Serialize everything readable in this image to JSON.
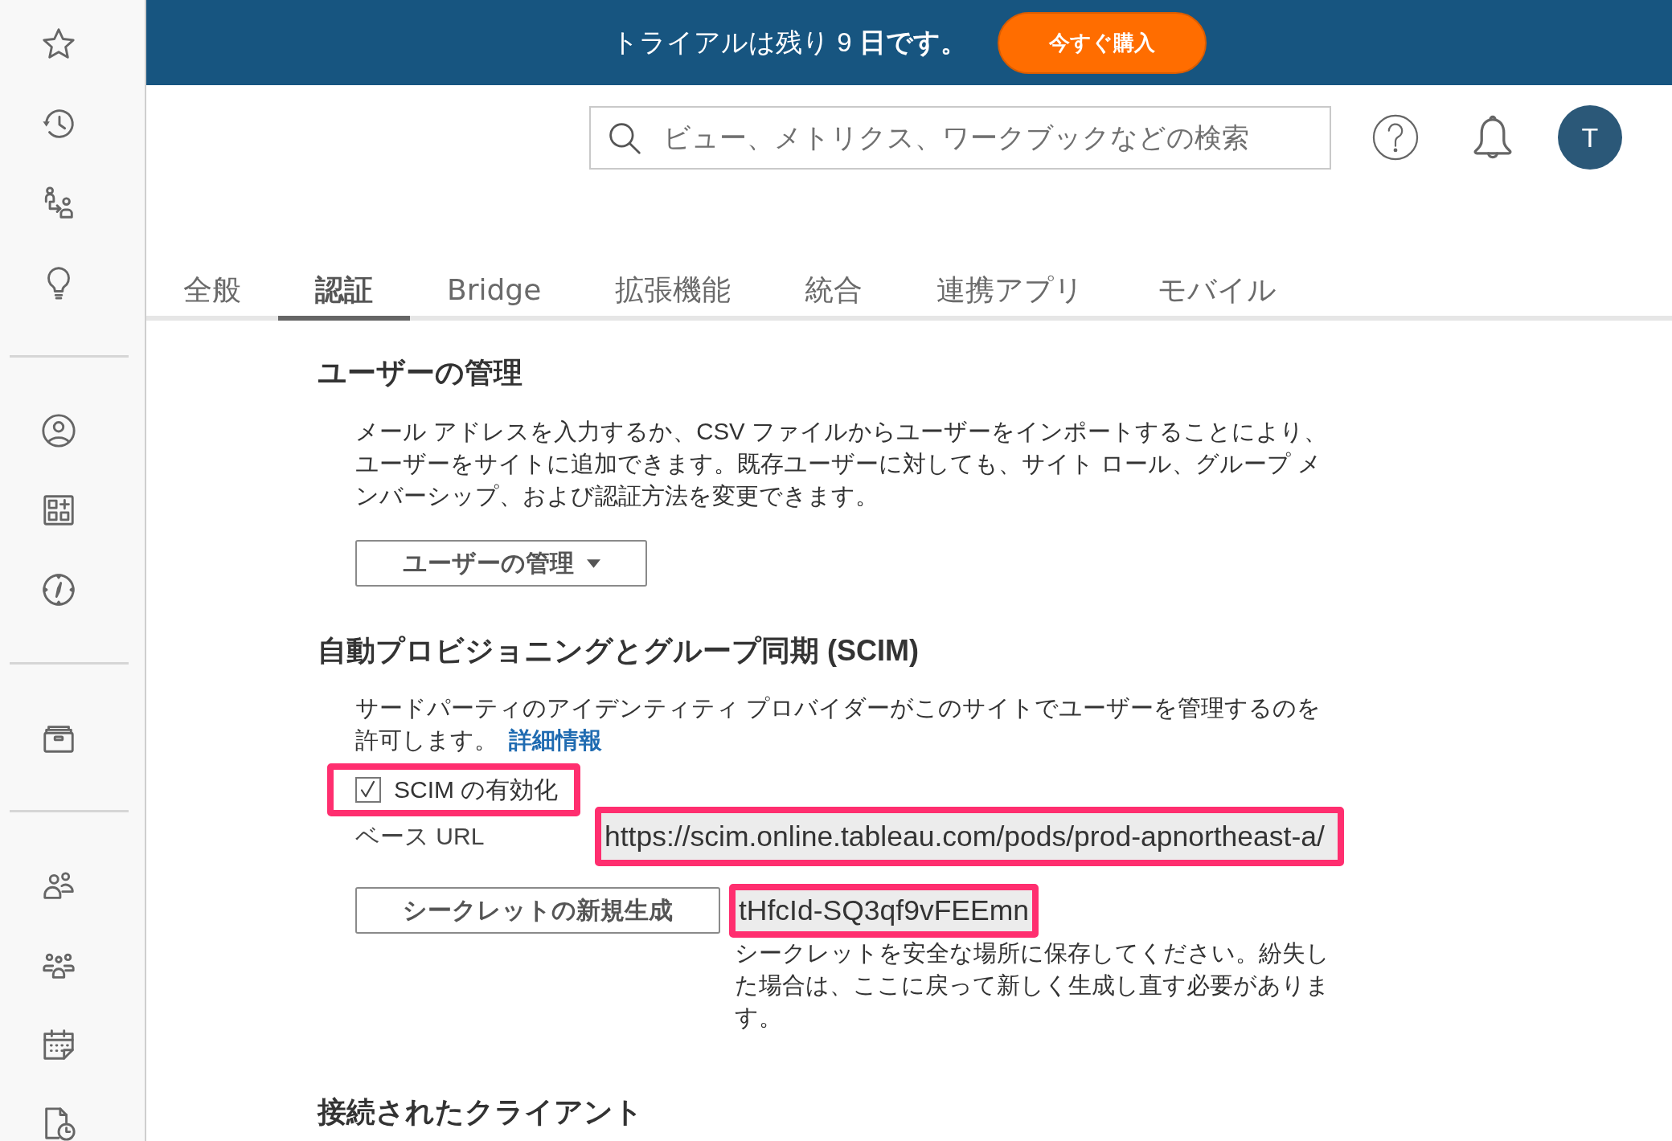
{
  "trial_banner": {
    "message": "トライアルは残り 9 **日です。**",
    "button": "今すぐ購入"
  },
  "header": {
    "search": {
      "placeholder": "ビュー、メトリクス、ワークブックなどの検索"
    },
    "avatar": "T"
  },
  "tabs": [
    {
      "label": "全般",
      "selected": false
    },
    {
      "label": "認証",
      "selected": true
    },
    {
      "label": "Bridge",
      "selected": false
    },
    {
      "label": "拡張機能",
      "selected": false
    },
    {
      "label": "統合",
      "selected": false
    },
    {
      "label": "連携アプリ",
      "selected": false
    },
    {
      "label": "モバイル",
      "selected": false
    }
  ],
  "sections": [
    {
      "kind": "user_management",
      "title": "ユーザーの管理",
      "description": "メール アドレスを入力するか、CSV ファイルからユーザーをインポートすることにより、ユーザーをサイトに追加できます。既存ユーザーに対しても、サイト ロール、グループ メンバーシップ、および認証方法を変更できます。",
      "menu_button": "ユーザーの管理"
    },
    {
      "kind": "scim",
      "title": "自動プロビジョニングとグループ同期 (SCIM)",
      "description": "サードパーティのアイデンティティ プロバイダーがこのサイトでユーザーを管理するのを許可します。",
      "link": "詳細情報",
      "enable_checkbox": {
        "label": "SCIM の有効化",
        "checked": true,
        "highlighted": true
      },
      "base_url": {
        "label": "ベース URL",
        "value": "https://scim.online.tableau.com/pods/prod-apnortheast-a/",
        "highlighted": true
      },
      "secret": {
        "button": "シークレットの新規生成",
        "value": "tHfcId-SQ3qf9vFEEmn",
        "highlighted": true,
        "note": "シークレットを安全な場所に保存してください。紛失した場合は、ここに戻って新しく生成し直す必要があります。"
      }
    },
    {
      "kind": "connected_clients",
      "title": "接続されたクライアント"
    }
  ]
}
